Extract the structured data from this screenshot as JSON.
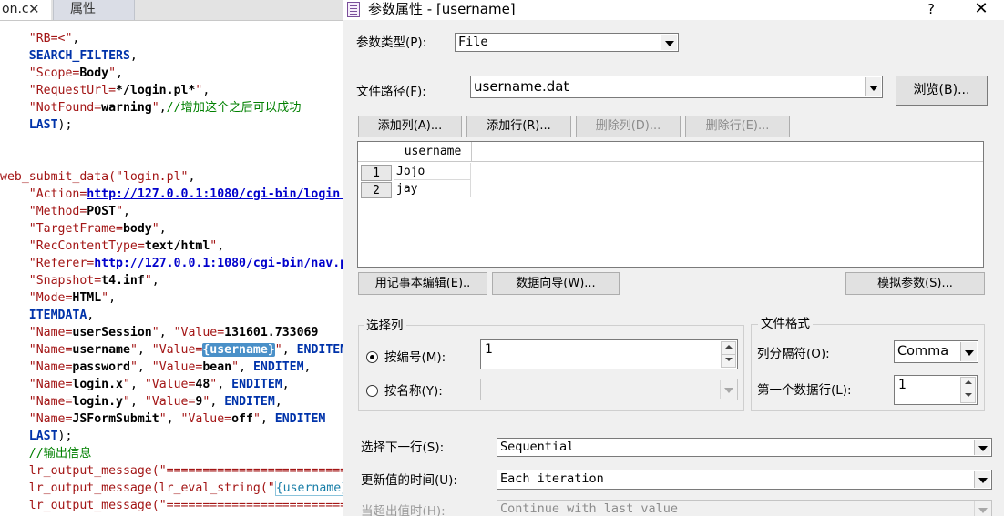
{
  "editor": {
    "tabs": [
      {
        "label": "on.c",
        "active": true
      },
      {
        "label": "属性",
        "active": false
      }
    ],
    "tab_close_glyph": "✕"
  },
  "dialog": {
    "title": "参数属性 - [username]",
    "help_glyph": "?",
    "close_glyph": "✕",
    "param_type_label": "参数类型(P):",
    "param_type_value": "File",
    "file_path_label": "文件路径(F):",
    "file_path_value": "username.dat",
    "browse_button": "浏览(B)...",
    "add_column_button": "添加列(A)...",
    "add_row_button": "添加行(R)...",
    "delete_column_button": "删除列(D)...",
    "delete_row_button": "删除行(E)...",
    "grid": {
      "columns": [
        "username"
      ],
      "rows": [
        {
          "num": "1",
          "cells": [
            "Jojo"
          ]
        },
        {
          "num": "2",
          "cells": [
            "jay"
          ]
        }
      ]
    },
    "notepad_edit_button": "用记事本编辑(E)..",
    "data_wizard_button": "数据向导(W)...",
    "simulate_param_button": "模拟参数(S)...",
    "select_column_group": "选择列",
    "by_number_label": "按编号(M):",
    "by_number_value": "1",
    "by_name_label": "按名称(Y):",
    "file_format_group": "文件格式",
    "column_delimiter_label": "列分隔符(O):",
    "column_delimiter_value": "Comma",
    "first_data_line_label": "第一个数据行(L):",
    "first_data_line_value": "1",
    "select_next_row_label": "选择下一行(S):",
    "select_next_row_value": "Sequential",
    "update_value_on_label": "更新值的时间(U):",
    "update_value_on_value": "Each iteration",
    "when_out_of_values_label": "当超出值时(H):",
    "when_out_of_values_value": "Continue with last value"
  },
  "colors": {
    "string": "#a31515",
    "keyword": "#0033aa",
    "comment": "#008000",
    "url": "#0000cc",
    "highlight": "#4a90c8",
    "dialog_bg": "#f0f0f0"
  }
}
